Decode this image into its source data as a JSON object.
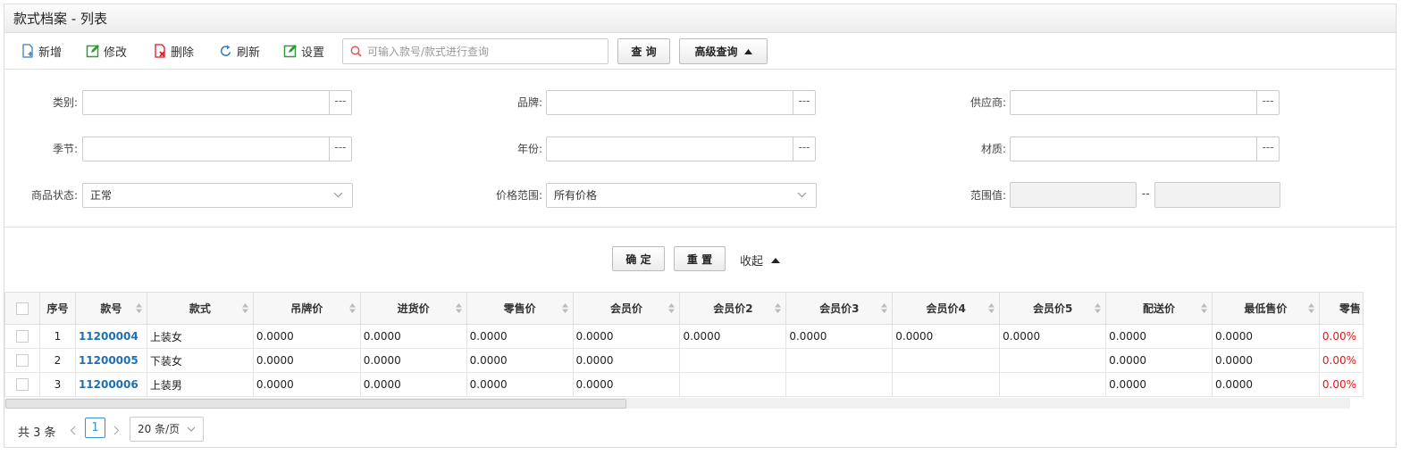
{
  "title": "款式档案 - 列表",
  "toolbar": {
    "add": "新增",
    "edit": "修改",
    "delete": "删除",
    "refresh": "刷新",
    "settings": "设置",
    "search_placeholder": "可输入款号/款式进行查询",
    "query": "查 询",
    "advanced_query": "高级查询"
  },
  "filters": {
    "category": "类别:",
    "brand": "品牌:",
    "supplier": "供应商:",
    "season": "季节:",
    "year": "年份:",
    "material": "材质:",
    "status_label": "商品状态:",
    "status_value": "正常",
    "price_range_label": "价格范围:",
    "price_range_value": "所有价格",
    "range_value_label": "范围值:",
    "range_sep": "--",
    "dots": "---"
  },
  "actions": {
    "confirm": "确 定",
    "reset": "重 置",
    "collapse": "收起"
  },
  "columns": [
    "序号",
    "款号",
    "款式",
    "吊牌价",
    "进货价",
    "零售价",
    "会员价",
    "会员价2",
    "会员价3",
    "会员价4",
    "会员价5",
    "配送价",
    "最低售价",
    "零售"
  ],
  "rows": [
    {
      "seq": "1",
      "code": "11200004",
      "style": "上装女",
      "tag": "0.0000",
      "purchase": "0.0000",
      "retail": "0.0000",
      "member": "0.0000",
      "member2": "0.0000",
      "member3": "0.0000",
      "member4": "0.0000",
      "member5": "0.0000",
      "delivery": "0.0000",
      "min": "0.0000",
      "pct": "0.00%"
    },
    {
      "seq": "2",
      "code": "11200005",
      "style": "下装女",
      "tag": "0.0000",
      "purchase": "0.0000",
      "retail": "0.0000",
      "member": "0.0000",
      "member2": "",
      "member3": "",
      "member4": "",
      "member5": "",
      "delivery": "0.0000",
      "min": "0.0000",
      "pct": "0.00%"
    },
    {
      "seq": "3",
      "code": "11200006",
      "style": "上装男",
      "tag": "0.0000",
      "purchase": "0.0000",
      "retail": "0.0000",
      "member": "0.0000",
      "member2": "",
      "member3": "",
      "member4": "",
      "member5": "",
      "delivery": "0.0000",
      "min": "0.0000",
      "pct": "0.00%"
    }
  ],
  "pager": {
    "total": "共 3 条",
    "page": "1",
    "page_size": "20 条/页"
  },
  "colors": {
    "link": "#1f6fb2",
    "red": "#e01818",
    "green": "#2e9b3c",
    "blue": "#3b7fc4"
  }
}
